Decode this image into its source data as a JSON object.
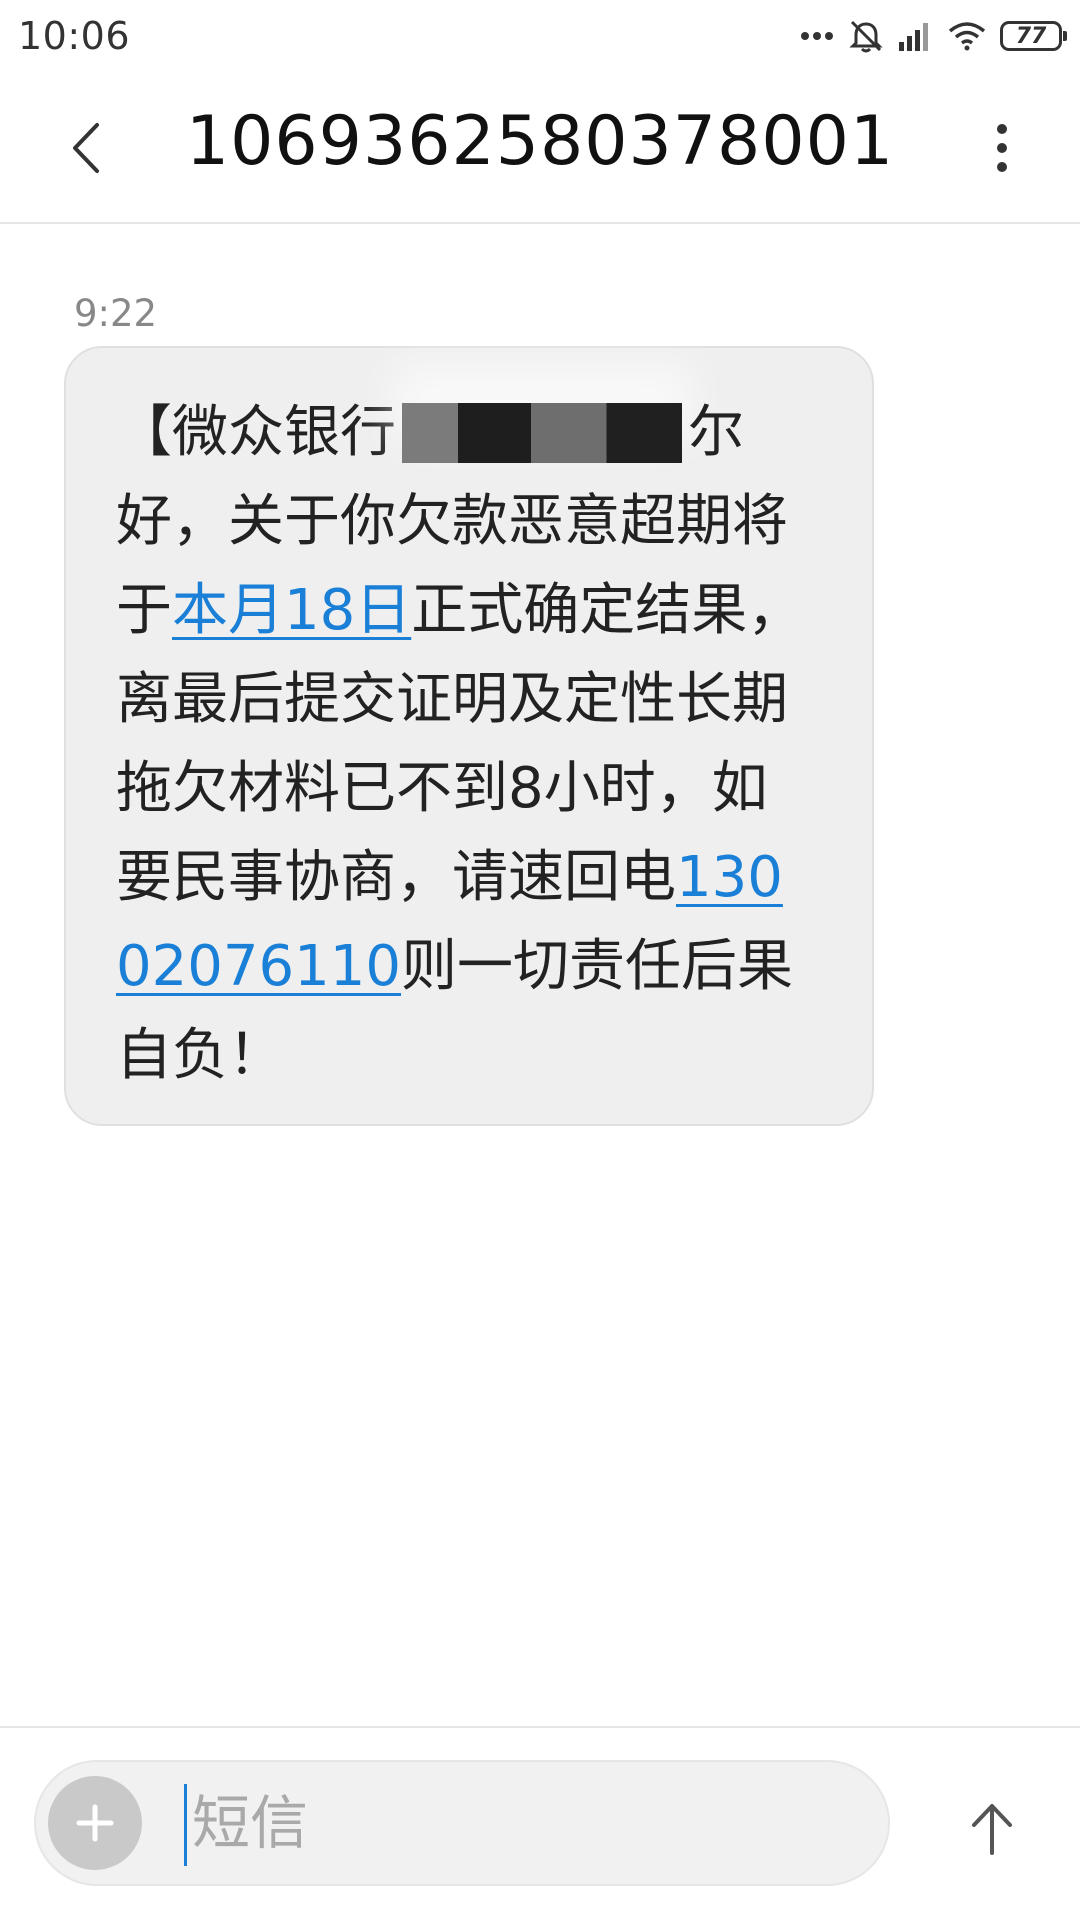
{
  "status_bar": {
    "time": "10:06",
    "battery": "77",
    "icons": [
      "more-dots-icon",
      "alarm-off-icon",
      "signal-icon",
      "wifi-icon",
      "battery-icon"
    ]
  },
  "header": {
    "title": "1069362580378001",
    "back_icon": "chevron-left-icon",
    "more_icon": "vertical-dots-icon"
  },
  "conversation": {
    "messages": [
      {
        "time": "9:22",
        "segments": {
          "part1": "【微众银行",
          "part2": "尔好，关于你欠款恶意超期将于",
          "date_link": "本月18日",
          "part3": "正式确定结果，离最后提交证明及定性长期拖欠材料已不到8小时，如要民事协商，请速回电",
          "phone_link": "13002076110",
          "part4": "则一切责任后果自负！"
        }
      }
    ]
  },
  "compose": {
    "placeholder": "短信",
    "add_icon": "plus-icon",
    "send_icon": "arrow-up-icon"
  },
  "colors": {
    "link": "#1a7fd6",
    "bubble": "#efefef",
    "add_button": "#c9c9c9"
  }
}
